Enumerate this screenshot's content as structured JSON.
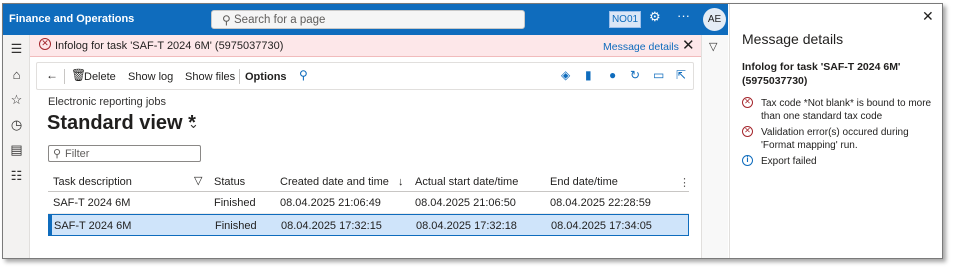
{
  "header": {
    "app_title": "Finance and Operations",
    "search_placeholder": "Search for a page",
    "company": "NO01",
    "avatar_initials": "AE",
    "more": "···"
  },
  "infolog": {
    "text": "Infolog for task 'SAF-T 2024 6M' (5975037730)",
    "details_link": "Message details",
    "close": "✕"
  },
  "actions": {
    "delete": "Delete",
    "show_log": "Show log",
    "show_files": "Show files",
    "options": "Options"
  },
  "page": {
    "breadcrumb": "Electronic reporting jobs",
    "title": "Standard view *",
    "filter_placeholder": "Filter"
  },
  "grid": {
    "columns": [
      "Task description",
      "Status",
      "Created date and time",
      "Actual start date/time",
      "End date/time"
    ],
    "sort_indicator": "↓",
    "rows": [
      {
        "task": "SAF-T 2024 6M",
        "status": "Finished",
        "created": "08.04.2025 21:06:49",
        "start": "08.04.2025 21:06:50",
        "end": "08.04.2025 22:28:59"
      },
      {
        "task": "SAF-T 2024 6M",
        "status": "Finished",
        "created": "08.04.2025 17:32:15",
        "start": "08.04.2025 17:32:18",
        "end": "08.04.2025 17:34:05"
      }
    ]
  },
  "panel": {
    "title": "Message details",
    "subtitle": "Infolog for task 'SAF-T 2024 6M' (5975037730)",
    "messages": [
      {
        "type": "error",
        "text": "Tax code *Not blank* is bound to more than one standard tax code"
      },
      {
        "type": "error",
        "text": "Validation error(s) occured during 'Format mapping' run."
      },
      {
        "type": "info",
        "text": "Export failed"
      }
    ]
  },
  "colors": {
    "brand": "#0f6cbd",
    "error": "#a4262c",
    "infobar_bg": "#fde7e9",
    "selected_row": "#cfe4fa"
  }
}
